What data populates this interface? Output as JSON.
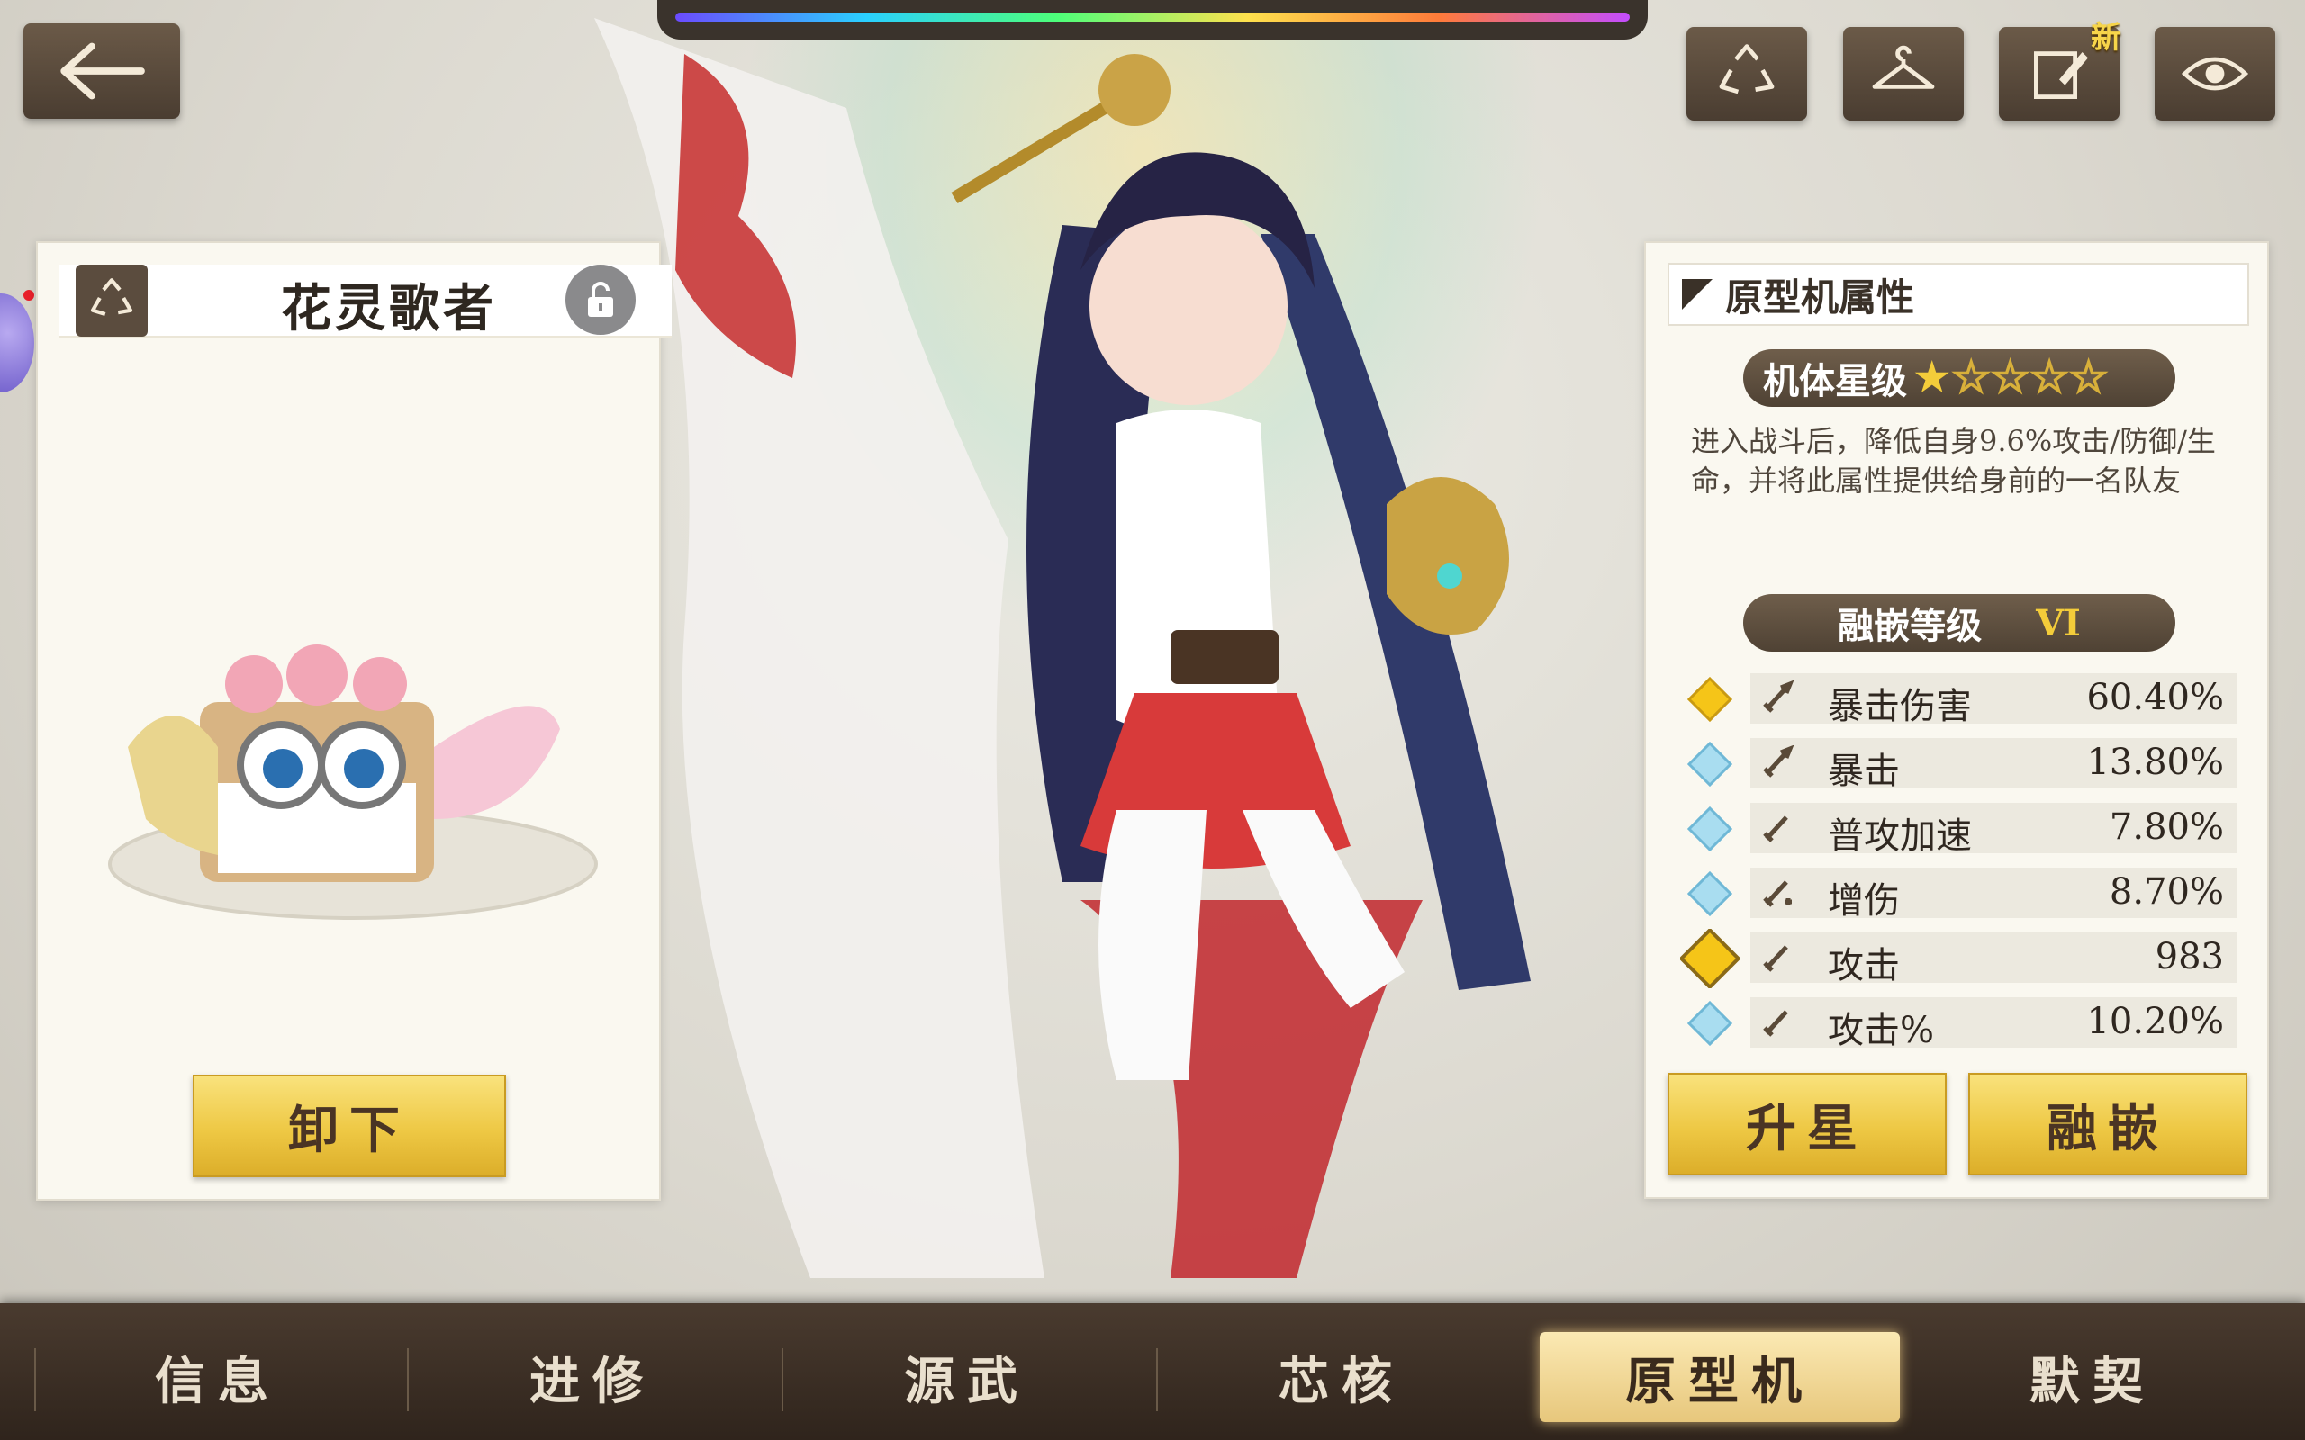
{
  "top_bar": {
    "back_icon": "arrow-left-icon",
    "buttons": [
      {
        "icon": "recycle-icon"
      },
      {
        "icon": "hanger-icon"
      },
      {
        "icon": "edit-note-icon",
        "badge": "新"
      },
      {
        "icon": "eye-icon"
      }
    ]
  },
  "left_panel": {
    "title": "花灵歌者",
    "unload_label": "卸下"
  },
  "right_panel": {
    "section_title": "原型机属性",
    "star_label": "机体星级",
    "stars": {
      "filled": 1,
      "total": 5
    },
    "description": "进入战斗后，降低自身9.6%攻击/防御/生命，并将此属性提供给身前的一名队友",
    "fusion_label": "融嵌等级",
    "fusion_level": "VI",
    "stats": [
      {
        "name": "暴击伤害",
        "value": "60.40%",
        "gem": "gold"
      },
      {
        "name": "暴击",
        "value": "13.80%",
        "gem": "blue"
      },
      {
        "name": "普攻加速",
        "value": "7.80%",
        "gem": "blue"
      },
      {
        "name": "增伤",
        "value": "8.70%",
        "gem": "blue"
      },
      {
        "name": "攻击",
        "value": "983",
        "gem": "gold-large"
      },
      {
        "name": "攻击%",
        "value": "10.20%",
        "gem": "blue"
      }
    ],
    "upgrade_star_label": "升星",
    "fusion_button_label": "融嵌"
  },
  "tabs": [
    {
      "label": "信息",
      "active": false
    },
    {
      "label": "进修",
      "active": false
    },
    {
      "label": "源武",
      "active": false
    },
    {
      "label": "芯核",
      "active": false
    },
    {
      "label": "原型机",
      "active": true
    },
    {
      "label": "默契",
      "active": false
    }
  ],
  "colors": {
    "gold": "#eec844",
    "panel_bg": "#faf8f0",
    "dark_brown": "#4a3d31",
    "gem_gold": "#f5c518",
    "gem_blue": "#a9ddf0"
  }
}
